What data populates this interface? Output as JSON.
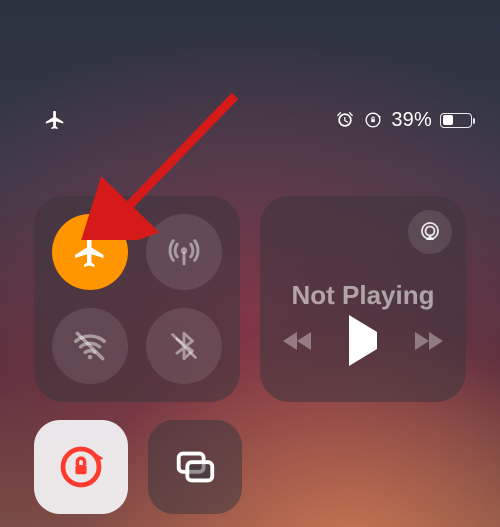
{
  "status": {
    "battery_percent_text": "39%",
    "battery_fill_percent": 39
  },
  "connectivity": {
    "airplane_mode_on": true
  },
  "media": {
    "title": "Not Playing"
  },
  "colors": {
    "airplane_orange": "#ff9500",
    "lock_red": "#ff3b30",
    "arrow_red": "#d61a1a"
  },
  "annotation": {
    "arrow_target": "airplane-mode-button"
  }
}
